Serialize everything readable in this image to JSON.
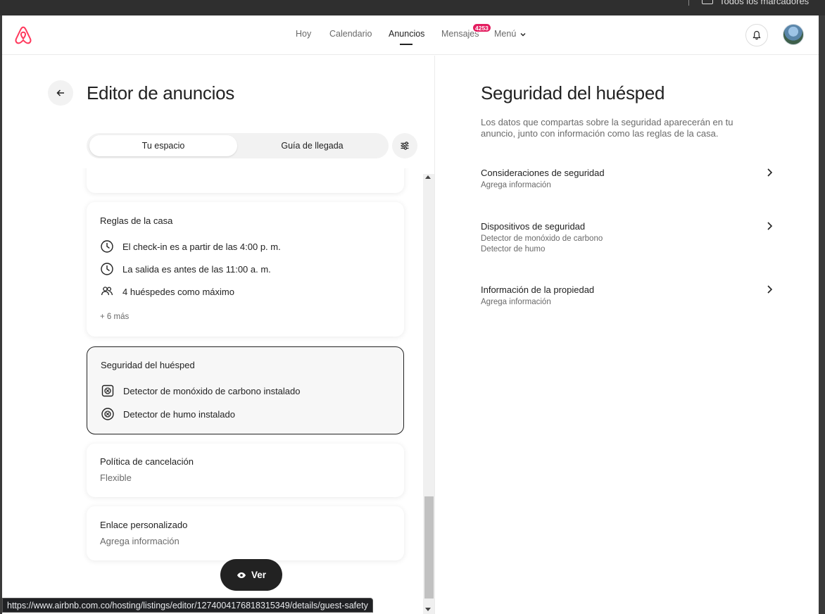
{
  "browser": {
    "bookmarks_label": "Todos los marcadores",
    "status_url": "https://www.airbnb.com.co/hosting/listings/editor/1274004176818315349/details/guest-safety"
  },
  "colors": {
    "brand": "#FF385C",
    "badge": "#E31C5F",
    "text_primary": "#222222",
    "text_secondary": "#6A6A6A",
    "button_dark": "#222222"
  },
  "nav": {
    "items": [
      "Hoy",
      "Calendario",
      "Anuncios",
      "Mensajes",
      "Menú"
    ],
    "active": "Anuncios",
    "messages_badge": "4253",
    "icons": {
      "logo": "airbnb-logo",
      "notifications": "bell-icon",
      "profile": "avatar",
      "menu": "chevron-down-icon"
    }
  },
  "left": {
    "title": "Editor de anuncios",
    "tabs": [
      {
        "label": "Tu espacio",
        "selected": true
      },
      {
        "label": "Guía de llegada",
        "selected": false
      }
    ],
    "cards": {
      "house_rules": {
        "title": "Reglas de la casa",
        "items": [
          {
            "icon": "clock-icon",
            "text": "El check-in es a partir de las 4:00 p. m."
          },
          {
            "icon": "clock-icon",
            "text": "La salida es antes de las 11:00 a. m."
          },
          {
            "icon": "people-icon",
            "text": "4 huéspedes como máximo"
          }
        ],
        "more": "+ 6 más"
      },
      "guest_safety": {
        "title": "Seguridad del huésped",
        "selected": true,
        "items": [
          {
            "icon": "co-detector-icon",
            "text": "Detector de monóxido de carbono instalado"
          },
          {
            "icon": "smoke-detector-icon",
            "text": "Detector de humo instalado"
          }
        ]
      },
      "cancellation": {
        "title": "Política de cancelación",
        "value": "Flexible"
      },
      "custom_link": {
        "title": "Enlace personalizado",
        "value": "Agrega información"
      }
    },
    "view_button": "Ver"
  },
  "right": {
    "title": "Seguridad del huésped",
    "description": "Los datos que compartas sobre la seguridad aparecerán en tu anuncio, junto con información como las reglas de la casa.",
    "sections": [
      {
        "title": "Consideraciones de seguridad",
        "lines": [
          "Agrega información"
        ]
      },
      {
        "title": "Dispositivos de seguridad",
        "lines": [
          "Detector de monóxido de carbono",
          "Detector de humo"
        ]
      },
      {
        "title": "Información de la propiedad",
        "lines": [
          "Agrega información"
        ]
      }
    ]
  }
}
